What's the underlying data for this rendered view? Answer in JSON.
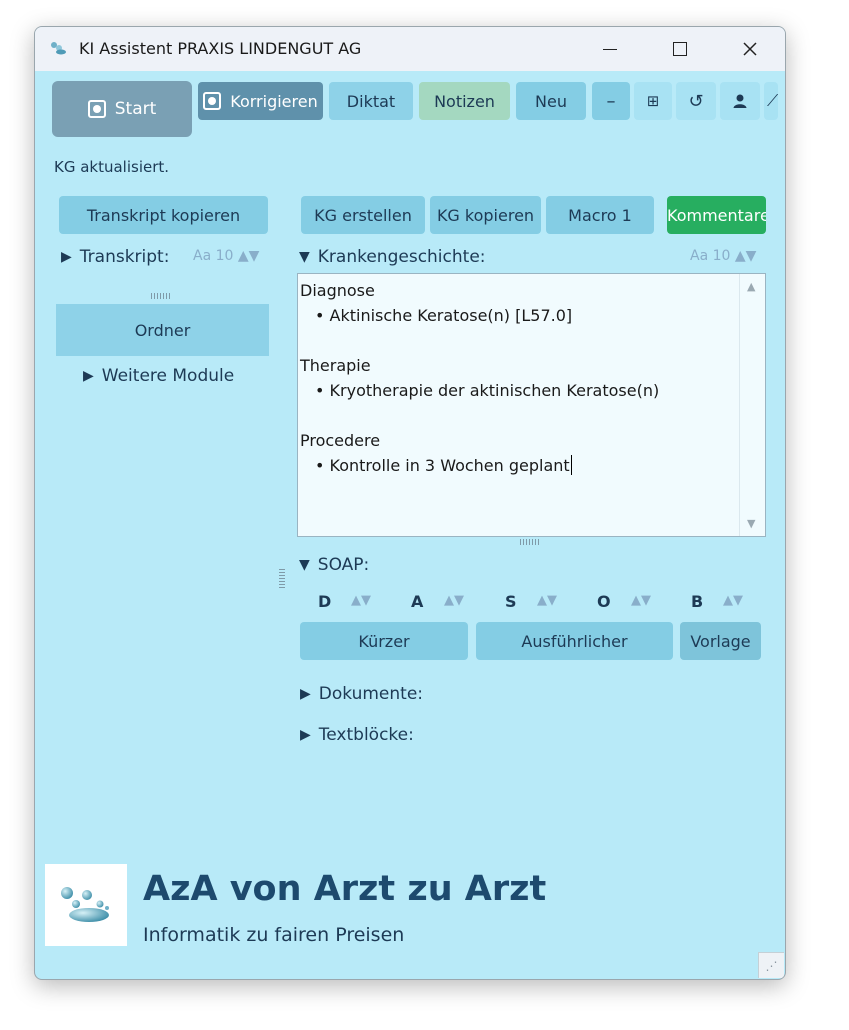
{
  "window": {
    "title": "KI Assistent PRAXIS LINDENGUT AG"
  },
  "toolbar": {
    "start": "Start",
    "korrigieren": "Korrigieren",
    "diktat": "Diktat",
    "notizen": "Notizen",
    "neu": "Neu",
    "minus": "–",
    "grid": "⊞",
    "refresh": "↺",
    "user": "👤",
    "more": "⟋"
  },
  "status": "KG aktualisiert.",
  "left": {
    "transkript_kopieren": "Transkript kopieren",
    "transkript_label": "Transkript:",
    "font_ctrl": "Aa  10",
    "ordner": "Ordner",
    "weitere_module": "Weitere Module"
  },
  "right": {
    "kg_erstellen": "KG erstellen",
    "kg_kopieren": "KG kopieren",
    "macro": "Macro 1",
    "kommentare": "Kommentare",
    "kg_label": "Krankengeschichte:",
    "font_ctrl": "Aa  10"
  },
  "editor": {
    "lines": [
      "Diagnose",
      "• Aktinische Keratose(n) [L57.0]",
      "",
      "Therapie",
      "• Kryotherapie der aktinischen Keratose(n)",
      "",
      "Procedere",
      "• Kontrolle in 3 Wochen geplant"
    ]
  },
  "soap": {
    "label": "SOAP:",
    "letters": [
      "D",
      "A",
      "S",
      "O",
      "B"
    ],
    "kurzer": "Kürzer",
    "ausfuhrlicher": "Ausführlicher",
    "vorlage": "Vorlage"
  },
  "sections": {
    "dokumente": "Dokumente:",
    "textbloecke": "Textblöcke:"
  },
  "brand": {
    "title": "AzA von Arzt zu Arzt",
    "subtitle": "Informatik zu fairen Preisen"
  },
  "colors": {
    "background": "#b8eaf8",
    "button": "#84cde4",
    "accent_green": "#27ae60",
    "text_dark": "#1d3a55"
  }
}
